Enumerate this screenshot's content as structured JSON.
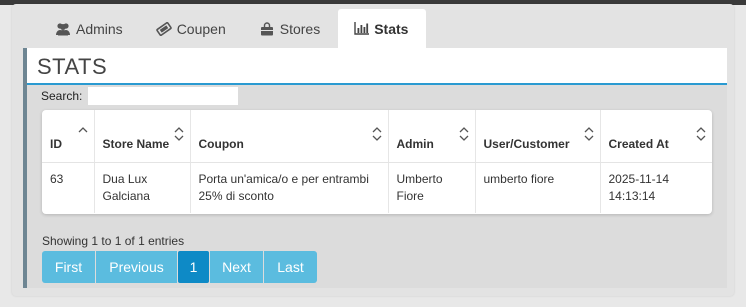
{
  "tabs": [
    {
      "label": "Admins",
      "icon": "users-icon"
    },
    {
      "label": "Coupen",
      "icon": "ticket-icon"
    },
    {
      "label": "Stores",
      "icon": "shopping-bag-icon"
    },
    {
      "label": "Stats",
      "icon": "bar-chart-icon",
      "active": true
    }
  ],
  "page": {
    "title": "STATS"
  },
  "search": {
    "label": "Search:",
    "value": ""
  },
  "table": {
    "columns": [
      "ID",
      "Store Name",
      "Coupon",
      "Admin",
      "User/Customer",
      "Created At"
    ],
    "rows": [
      {
        "id": "63",
        "store": "Dua Lux Galciana",
        "coupon": "Porta un'amica/o e per entrambi 25% di sconto",
        "admin": "Umberto Fiore",
        "customer": "umberto fiore",
        "created": "2025-11-14 14:13:14"
      }
    ]
  },
  "info": "Showing 1 to 1 of 1 entries",
  "pagination": {
    "first": "First",
    "previous": "Previous",
    "current": "1",
    "next": "Next",
    "last": "Last"
  },
  "colors": {
    "accent": "#2a9ad1",
    "button": "#5bbcdf",
    "button_active": "#0e8ac6",
    "sidebar_border": "#6e8693"
  }
}
